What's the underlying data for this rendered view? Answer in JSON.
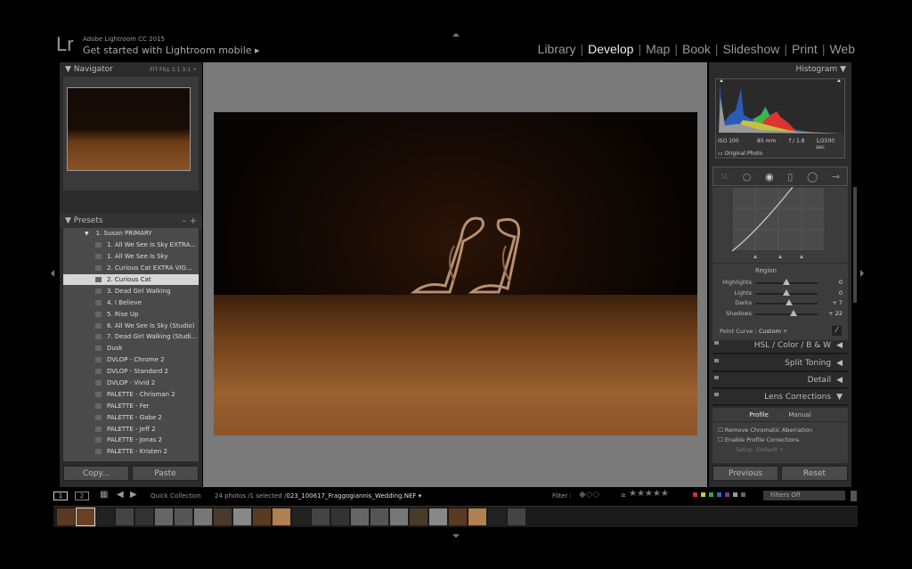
{
  "app": {
    "logo": "Lr",
    "name": "Adobe Lightroom CC 2015",
    "mobile_prompt": "Get started with Lightroom mobile ▸"
  },
  "modules": [
    "Library",
    "Develop",
    "Map",
    "Book",
    "Slideshow",
    "Print",
    "Web"
  ],
  "active_module": "Develop",
  "navigator": {
    "title": "Navigator",
    "zoom": "FIT   FILL   1:1   3:1 ÷"
  },
  "presets": {
    "title": "Presets",
    "controls": "–  +",
    "folder": "1. Susan PRIMARY",
    "items": [
      "1.  All We See Is Sky EXTRA...",
      "1. All We See Is Sky",
      "2.  Curious Cat EXTRA VIG...",
      "2. Curious Cat",
      "3. Dead Girl Walking",
      "4. I Believe",
      "5. Rise Up",
      "6. All We See Is Sky (Studio)",
      "7. Dead Girl Walking (Studi...",
      "Dusk",
      "DVLOP - Chrome 2",
      "DVLOP - Standard 2",
      "DVLOP - Vivid 2",
      "PALETTE - Chrisman 2",
      "PALETTE - Fer",
      "PALETTE - Gabe 2",
      "PALETTE - Jeff 2",
      "PALETTE - Jonas 2",
      "PALETTE - Kristen 2"
    ],
    "selected": "2. Curious Cat"
  },
  "left_buttons": {
    "copy": "Copy...",
    "paste": "Paste"
  },
  "histogram": {
    "title": "Histogram",
    "iso": "ISO 100",
    "focal": "85 mm",
    "aperture": "f / 1.8",
    "shutter": "1/2500 sec",
    "original_photo": "Original Photo"
  },
  "tone_curve": {
    "region_title": "Region",
    "sliders": [
      {
        "label": "Highlights",
        "value": "0",
        "pos": 0.5
      },
      {
        "label": "Lights",
        "value": "0",
        "pos": 0.5
      },
      {
        "label": "Darks",
        "value": "+ 7",
        "pos": 0.54
      },
      {
        "label": "Shadows",
        "value": "+ 22",
        "pos": 0.61
      }
    ],
    "point_curve_label": "Point Curve :",
    "point_curve_value": "Custom ÷"
  },
  "sections": [
    {
      "label": "HSL  /  Color  /  B & W",
      "state": "◀"
    },
    {
      "label": "Split Toning",
      "state": "◀"
    },
    {
      "label": "Detail",
      "state": "◀"
    },
    {
      "label": "Lens Corrections",
      "state": "▼"
    }
  ],
  "lens": {
    "tabs": [
      "Profile",
      "Manual"
    ],
    "checkboxes": [
      "Remove Chromatic Aberration",
      "Enable Profile Corrections"
    ],
    "setup_label": "Setup",
    "setup_value": "Default ÷"
  },
  "right_buttons": {
    "previous": "Previous",
    "reset": "Reset"
  },
  "bottombar": {
    "screen1": "1",
    "screen2": "2",
    "source": "Quick Collection",
    "count": "24 photos /1 selected /",
    "filename": "023_100617_Fraggogiannis_Wedding.NEF ▾",
    "filter_label": "Filter :",
    "gte": "≥",
    "filters": "Filters Off"
  },
  "colors": {
    "accent_text": "#eeeeee",
    "panel": "#2b2b2b",
    "label_colors": [
      "#c33",
      "#cc3",
      "#3a3",
      "#36c",
      "#838",
      "#999",
      "#666"
    ]
  }
}
